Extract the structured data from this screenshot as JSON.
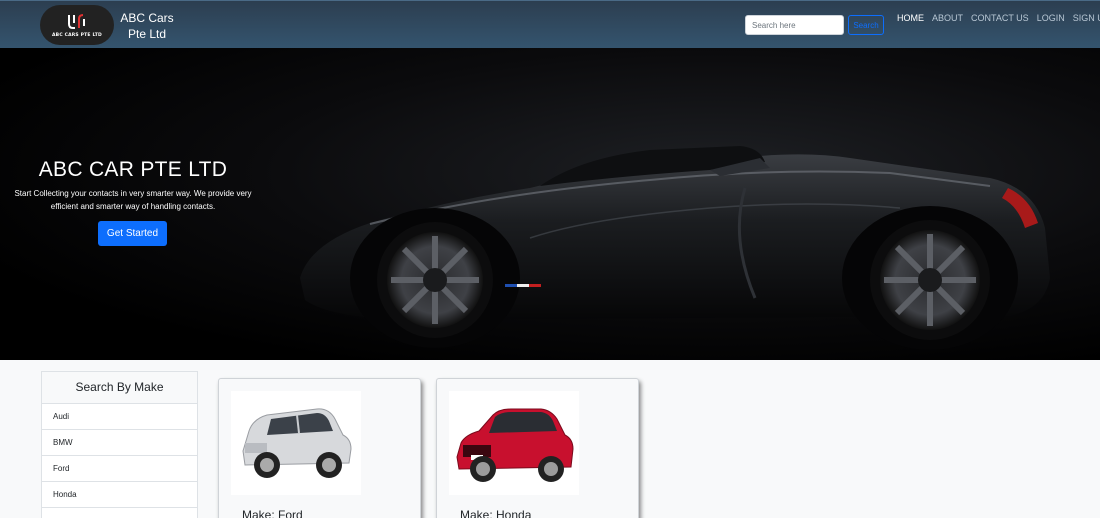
{
  "brand": {
    "logo_text": "ABC CARS PTE LTD",
    "name_line1": "ABC Cars",
    "name_line2": "Pte Ltd"
  },
  "search": {
    "placeholder": "Search here",
    "button_label": "Search"
  },
  "nav": {
    "items": [
      "HOME",
      "ABOUT",
      "CONTACT US",
      "LOGIN",
      "SIGN UP"
    ],
    "active": "HOME"
  },
  "hero": {
    "title": "ABC CAR PTE LTD",
    "text": "Start Collecting your contacts in very smarter way. We provide very efficient and smarter way of handling contacts.",
    "cta_label": "Get Started"
  },
  "sidebar": {
    "title": "Search By Make",
    "items": [
      "Audi",
      "BMW",
      "Ford",
      "Honda"
    ]
  },
  "cards": [
    {
      "title": "Make: Ford",
      "image": "silver-suv-image"
    },
    {
      "title": "Make: Honda",
      "image": "red-sedan-image"
    }
  ],
  "colors": {
    "nav_bg": "#2c3e50",
    "primary": "#0d6efd",
    "hero_bg": "#000000"
  }
}
